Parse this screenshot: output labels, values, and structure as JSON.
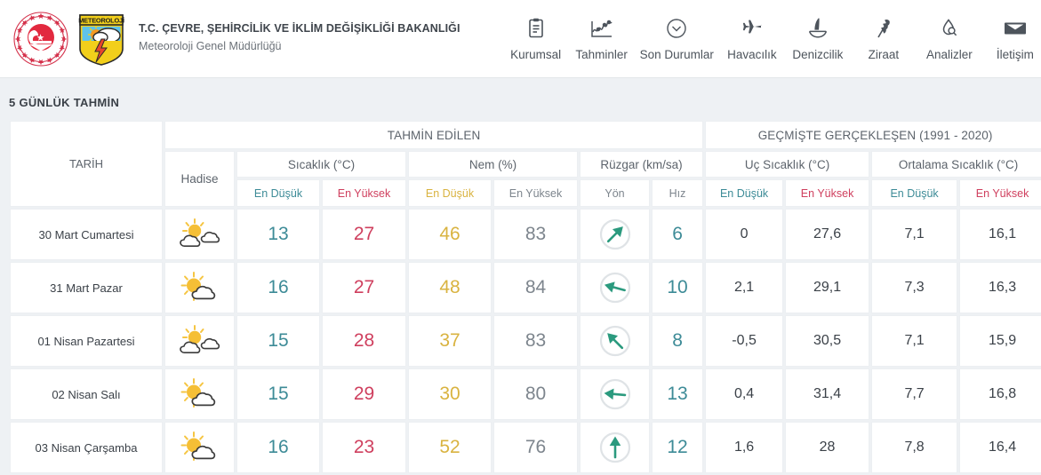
{
  "header": {
    "ministry_title": "T.C. ÇEVRE, ŞEHİRCİLİK VE İKLİM DEĞİŞİKLİĞİ BAKANLIĞI",
    "department_title": "Meteoroloji Genel Müdürlüğü",
    "met_logo_text": "METEOROLOJİ",
    "nav": [
      {
        "label": "Kurumsal",
        "icon": "clipboard-icon"
      },
      {
        "label": "Tahminler",
        "icon": "chart-line-icon"
      },
      {
        "label": "Son Durumlar",
        "icon": "chevron-down-circle-icon"
      },
      {
        "label": "Havacılık",
        "icon": "airplane-icon"
      },
      {
        "label": "Denizcilik",
        "icon": "sailboat-icon"
      },
      {
        "label": "Ziraat",
        "icon": "wheat-icon"
      },
      {
        "label": "Analizler",
        "icon": "water-drop-search-icon"
      },
      {
        "label": "İletişim",
        "icon": "envelope-icon"
      }
    ]
  },
  "section": {
    "title": "5 GÜNLÜK TAHMİN"
  },
  "table": {
    "group_forecast": "TAHMİN EDİLEN",
    "group_historical": "GEÇMİŞTE GERÇEKLEŞEN (1991 - 2020)",
    "col_date": "TARİH",
    "col_event": "Hadise",
    "sub_temp": "Sıcaklık (°C)",
    "sub_humidity": "Nem (%)",
    "sub_wind": "Rüzgar (km/sa)",
    "sub_extreme_temp": "Uç Sıcaklık (°C)",
    "sub_avg_temp": "Ortalama Sıcaklık (°C)",
    "leaf_min": "En Düşük",
    "leaf_max": "En Yüksek",
    "leaf_dir": "Yön",
    "leaf_speed": "Hız",
    "colors": {
      "min_temp": "#3d8b97",
      "max_temp": "#cf3f5e",
      "min_humidity": "#d9b340",
      "max_humidity": "#7d858d",
      "wind_speed": "#3d8b97",
      "wind_arrow": "#2b9a7e"
    },
    "rows": [
      {
        "date": "30 Mart Cumartesi",
        "event_icon": "sun-two-clouds-icon",
        "temp_min": "13",
        "temp_max": "27",
        "hum_min": "46",
        "hum_max": "83",
        "wind_dir_deg": 225,
        "wind_speed": "6",
        "hist_extreme_min": "0",
        "hist_extreme_max": "27,6",
        "hist_avg_min": "7,1",
        "hist_avg_max": "16,1"
      },
      {
        "date": "31 Mart Pazar",
        "event_icon": "sun-one-cloud-icon",
        "temp_min": "16",
        "temp_max": "27",
        "hum_min": "48",
        "hum_max": "84",
        "wind_dir_deg": 105,
        "wind_speed": "10",
        "hist_extreme_min": "2,1",
        "hist_extreme_max": "29,1",
        "hist_avg_min": "7,3",
        "hist_avg_max": "16,3"
      },
      {
        "date": "01 Nisan Pazartesi",
        "event_icon": "sun-two-clouds-icon",
        "temp_min": "15",
        "temp_max": "28",
        "hum_min": "37",
        "hum_max": "83",
        "wind_dir_deg": 135,
        "wind_speed": "8",
        "hist_extreme_min": "-0,5",
        "hist_extreme_max": "30,5",
        "hist_avg_min": "7,1",
        "hist_avg_max": "15,9"
      },
      {
        "date": "02 Nisan Salı",
        "event_icon": "sun-one-cloud-icon",
        "temp_min": "15",
        "temp_max": "29",
        "hum_min": "30",
        "hum_max": "80",
        "wind_dir_deg": 95,
        "wind_speed": "13",
        "hist_extreme_min": "0,4",
        "hist_extreme_max": "31,4",
        "hist_avg_min": "7,7",
        "hist_avg_max": "16,8"
      },
      {
        "date": "03 Nisan Çarşamba",
        "event_icon": "sun-one-cloud-icon",
        "temp_min": "16",
        "temp_max": "23",
        "hum_min": "52",
        "hum_max": "76",
        "wind_dir_deg": 180,
        "wind_speed": "12",
        "hist_extreme_min": "1,6",
        "hist_extreme_max": "28",
        "hist_avg_min": "7,8",
        "hist_avg_max": "16,4"
      }
    ]
  }
}
